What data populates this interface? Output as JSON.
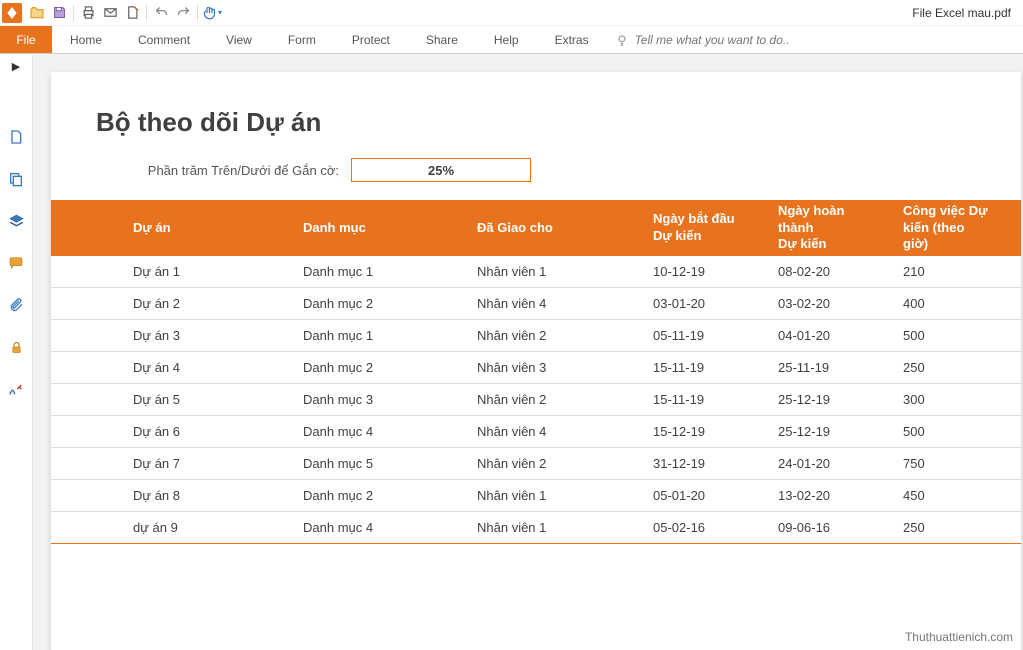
{
  "window_title": "File Excel mau.pdf",
  "file_tab": "File",
  "ribbon_tabs": [
    "Home",
    "Comment",
    "View",
    "Form",
    "Protect",
    "Share",
    "Help",
    "Extras"
  ],
  "tell_me_placeholder": "Tell me what you want to do..",
  "doc": {
    "title": "Bộ theo dõi Dự án",
    "percent_label": "Phần trăm Trên/Dưới để Gắn cờ:",
    "percent_value": "25%",
    "headers": {
      "c1": "Dự án",
      "c2": "Danh mục",
      "c3": "Đã Giao cho",
      "c4": "Ngày bắt đầu Dự kiến",
      "c5": "Ngày hoàn thành\nDự kiến",
      "c6": "Công việc Dự kiến (theo giờ)"
    },
    "rows": [
      {
        "c1": "Dự án 1",
        "c2": "Danh mục 1",
        "c3": "Nhân viên 1",
        "c4": "10-12-19",
        "c5": "08-02-20",
        "c6": "210"
      },
      {
        "c1": "Dự án 2",
        "c2": "Danh mục 2",
        "c3": "Nhân viên 4",
        "c4": "03-01-20",
        "c5": "03-02-20",
        "c6": "400"
      },
      {
        "c1": "Dự án 3",
        "c2": "Danh mục 1",
        "c3": "Nhân viên 2",
        "c4": "05-11-19",
        "c5": "04-01-20",
        "c6": "500"
      },
      {
        "c1": "Dự án 4",
        "c2": "Danh mục 2",
        "c3": "Nhân viên 3",
        "c4": "15-11-19",
        "c5": "25-11-19",
        "c6": "250"
      },
      {
        "c1": "Dự án 5",
        "c2": "Danh mục 3",
        "c3": "Nhân viên 2",
        "c4": "15-11-19",
        "c5": "25-12-19",
        "c6": "300"
      },
      {
        "c1": "Dự án 6",
        "c2": "Danh mục 4",
        "c3": "Nhân viên 4",
        "c4": "15-12-19",
        "c5": "25-12-19",
        "c6": "500"
      },
      {
        "c1": "Dự án 7",
        "c2": "Danh mục 5",
        "c3": "Nhân viên 2",
        "c4": "31-12-19",
        "c5": "24-01-20",
        "c6": "750"
      },
      {
        "c1": "Dự án 8",
        "c2": "Danh mục 2",
        "c3": "Nhân viên 1",
        "c4": "05-01-20",
        "c5": "13-02-20",
        "c6": "450"
      },
      {
        "c1": "dự án 9",
        "c2": "Danh mục 4",
        "c3": "Nhân viên 1",
        "c4": "05-02-16",
        "c5": "09-06-16",
        "c6": "250"
      }
    ]
  },
  "watermark": "Thuthuattienich.com"
}
